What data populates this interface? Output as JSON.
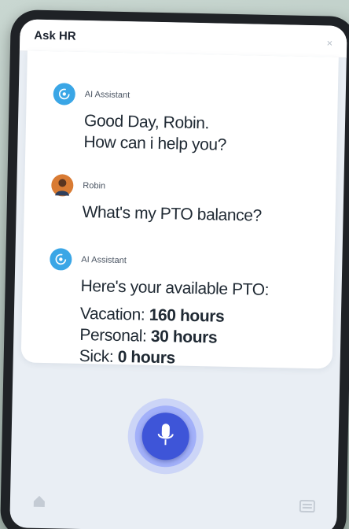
{
  "header": {
    "title": "Ask HR",
    "close_glyph": "×"
  },
  "messages": [
    {
      "sender": "AI Assistant",
      "avatar": "ai-assistant-icon",
      "lines": [
        "Good Day, Robin.",
        "How can i help you?"
      ]
    },
    {
      "sender": "Robin",
      "avatar": "user-avatar",
      "lines": [
        "What's my PTO balance?"
      ]
    },
    {
      "sender": "AI Assistant",
      "avatar": "ai-assistant-icon",
      "intro": "Here's your available PTO:",
      "pto": [
        {
          "label": "Vacation: ",
          "value": "160 hours"
        },
        {
          "label": "Personal: ",
          "value": "30 hours"
        },
        {
          "label": "Sick: ",
          "value": "0 hours"
        }
      ]
    }
  ],
  "controls": {
    "mic": "microphone-icon",
    "home": "home-icon",
    "keyboard": "keyboard-icon"
  },
  "colors": {
    "accent": "#3e55d8",
    "ai_avatar": "#3aa6e6",
    "user_avatar": "#d97b33"
  }
}
